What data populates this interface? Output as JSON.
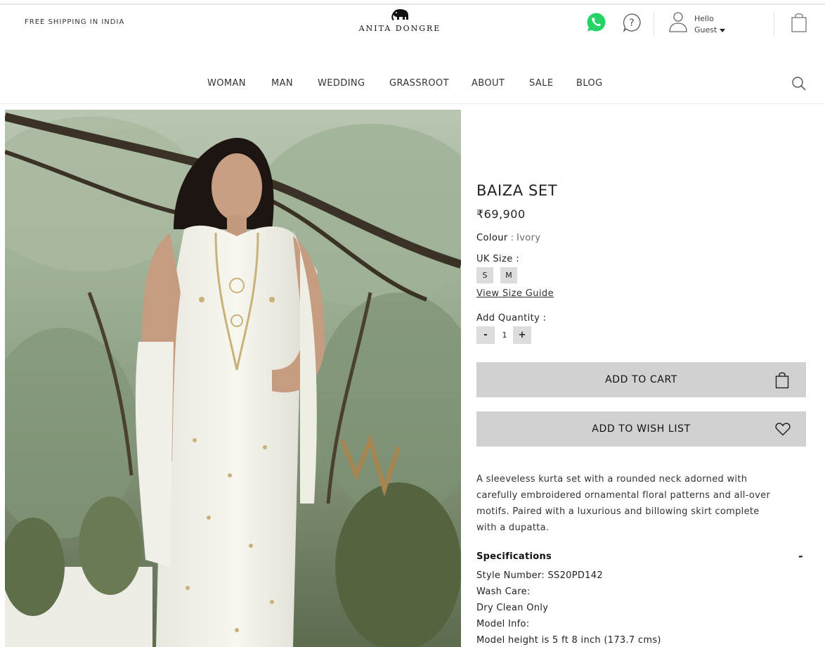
{
  "header": {
    "shipping_note": "FREE SHIPPING IN INDIA",
    "logo_text": "ANITA DONGRE",
    "greeting": "Hello",
    "user_name": "Guest"
  },
  "nav": {
    "items": [
      "WOMAN",
      "MAN",
      "WEDDING",
      "GRASSROOT",
      "ABOUT",
      "SALE",
      "BLOG"
    ]
  },
  "product": {
    "title": "BAIZA SET",
    "price": "₹69,900",
    "colour_label": "Colour",
    "colour_separator": ":",
    "colour_value": "Ivory",
    "size_label": "UK Size :",
    "sizes": [
      "S",
      "M"
    ],
    "size_guide": "View Size Guide",
    "quantity_label": "Add Quantity :",
    "quantity_minus": "-",
    "quantity_value": "1",
    "quantity_plus": "+",
    "add_to_cart": "ADD TO CART",
    "add_to_wishlist": "ADD TO WISH LIST",
    "description": "A sleeveless kurta set with a rounded neck adorned with carefully embroidered ornamental floral patterns and all-over motifs. Paired with a luxurious and billowing skirt complete with a dupatta.",
    "specifications": {
      "title": "Specifications",
      "toggle": "-",
      "lines": [
        "Style Number: SS20PD142",
        "Wash Care:",
        "Dry Clean Only",
        "Model Info:",
        "Model height is 5 ft 8 inch (173.7 cms)"
      ]
    }
  },
  "icons": {
    "whatsapp": "whatsapp-icon",
    "help": "help-icon",
    "user": "user-icon",
    "bag": "shopping-bag-icon",
    "search": "search-icon",
    "heart": "heart-icon",
    "logo_mark": "elephant-icon"
  },
  "colors": {
    "whatsapp_green": "#25d366",
    "button_gray": "#d1d1d1",
    "size_gray": "#dcdcdc"
  }
}
